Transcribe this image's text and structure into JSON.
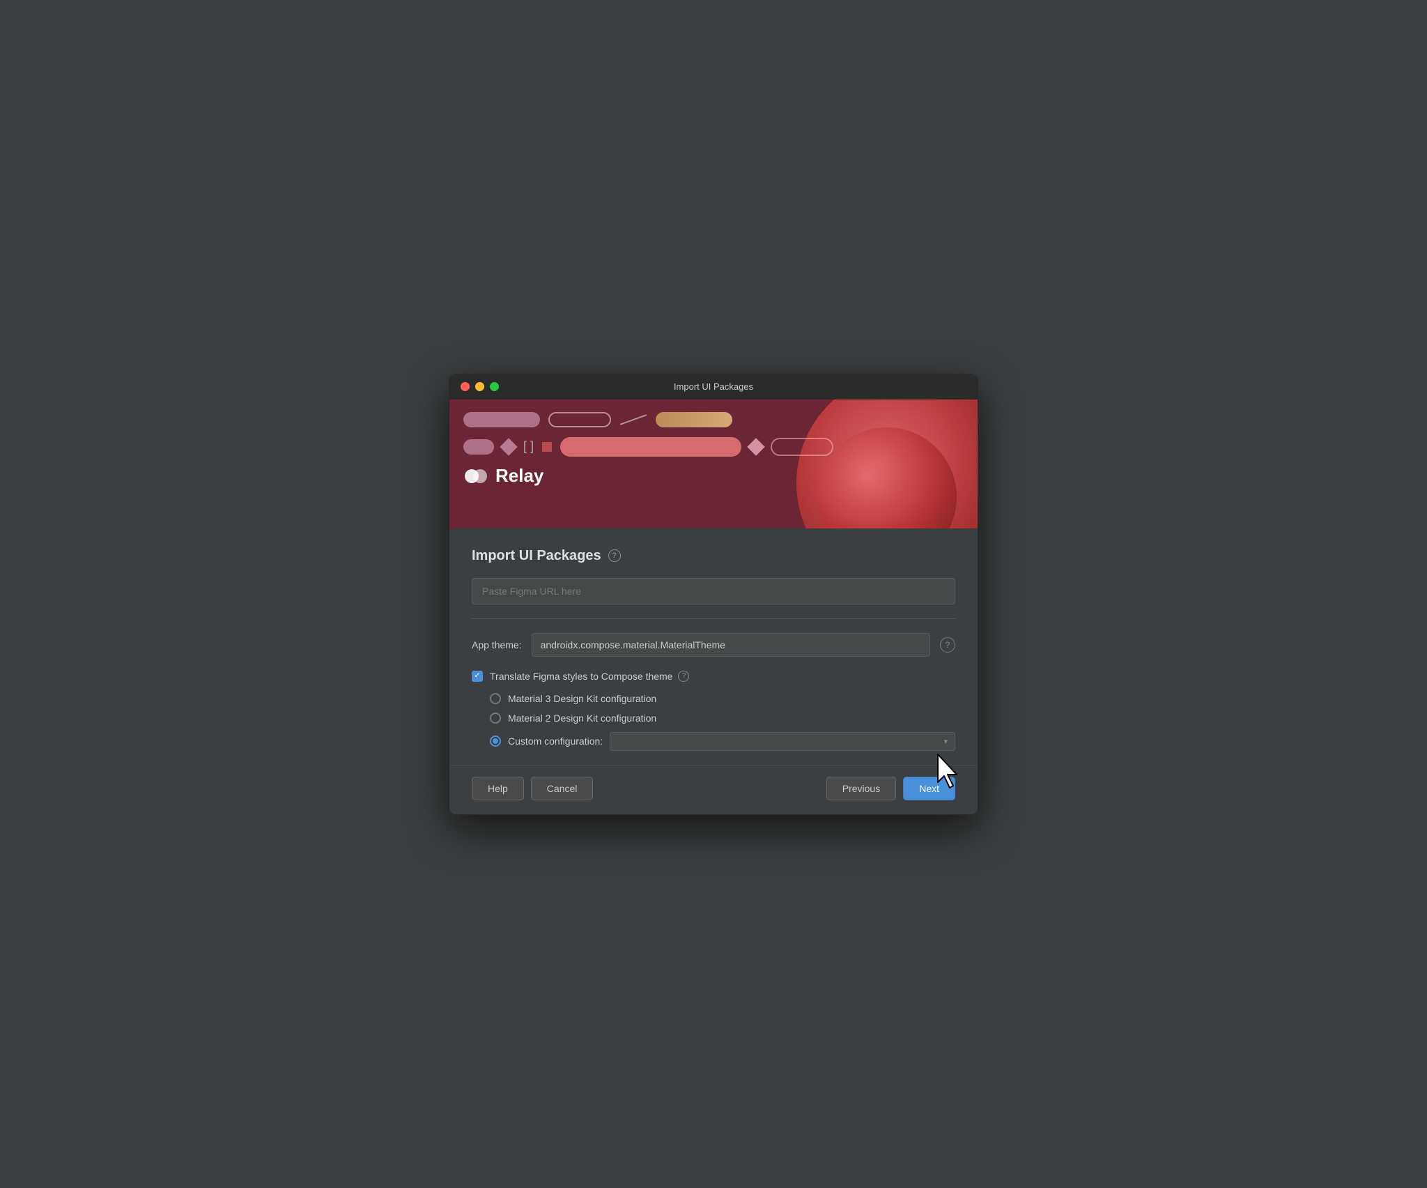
{
  "window": {
    "title": "Import UI Packages"
  },
  "hero": {
    "logo_text": "Relay"
  },
  "main": {
    "title": "Import UI Packages",
    "url_input_placeholder": "Paste Figma URL here",
    "url_input_value": "",
    "app_theme_label": "App theme:",
    "app_theme_value": "androidx.compose.material.MaterialTheme",
    "translate_checkbox_label": "Translate Figma styles to Compose theme",
    "translate_checked": true,
    "radio_options": [
      {
        "id": "material3",
        "label": "Material 3 Design Kit configuration",
        "selected": false
      },
      {
        "id": "material2",
        "label": "Material 2 Design Kit configuration",
        "selected": false
      },
      {
        "id": "custom",
        "label": "Custom configuration:",
        "selected": true
      }
    ],
    "custom_config_value": ""
  },
  "footer": {
    "help_label": "Help",
    "cancel_label": "Cancel",
    "previous_label": "Previous",
    "next_label": "Next"
  },
  "icons": {
    "help_question": "?",
    "chevron_down": "▾",
    "checkmark": "✓"
  }
}
